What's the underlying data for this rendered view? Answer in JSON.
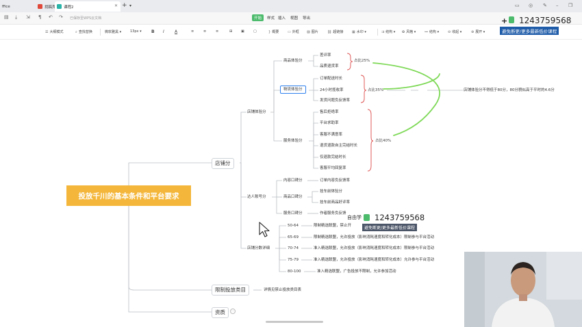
{
  "tabs": [
    {
      "label": "ffice"
    },
    {
      "label": "找稿壳模板"
    },
    {
      "label": "课程2"
    }
  ],
  "titlebar": {
    "saved": "已保存至WPS云文档",
    "menus": [
      "开始",
      "样式",
      "插入",
      "视图",
      "导出"
    ]
  },
  "toolbar": {
    "items": [
      "大纲模式",
      "查找替换",
      "微软雅黑",
      "13px",
      "B",
      "I",
      "A",
      "概要",
      "外框",
      "图片",
      "超链接",
      "水印",
      "结构",
      "风格",
      "结构",
      "收起",
      "展开"
    ]
  },
  "promo": {
    "number": "1243759568",
    "subtitle": "避免断更/更多最新低价课程",
    "plus": "+"
  },
  "watermark": {
    "prefix": "自由学",
    "number": "1243759568",
    "subtitle": "避免断更/更多最新低价课程"
  },
  "mindmap": {
    "root": "投放千川的基本条件和平台要求",
    "level1": [
      "店铺分",
      "限制投放类目",
      "资质"
    ],
    "level2": [
      "店铺体验分",
      "达人账号分",
      "店铺分数详细"
    ],
    "store_exp": {
      "groups": [
        "商品体验分",
        "物流体验分",
        "服务体验分"
      ],
      "goods": [
        "差评率",
        "品质退货率"
      ],
      "goods_share": "占比25%",
      "logistics": [
        "订单配送时长",
        "24小时揽收率",
        "发货问题负反馈率"
      ],
      "logistics_share": "占比35%",
      "logistics_note": "店铺体验分不得低于80分，80分貌似高于平时的4.6分",
      "service": [
        "售后拒绝率",
        "平台求助率",
        "客服不满意率",
        "退货退款自主完结时长",
        "仅退款完结时长",
        "客服平均回复率"
      ],
      "service_share": "占比40%"
    },
    "talent": {
      "groups": [
        "内容口碑分",
        "商品口碑分",
        "服务口碑分"
      ],
      "content": "订单内容负反馈率",
      "goods": [
        "挂车前体验分",
        "挂车前商品好评率"
      ],
      "service": "作者服务负反馈"
    },
    "score_detail": {
      "rows": [
        {
          "range": "50-64",
          "text": "限制精选联盟，禁止开"
        },
        {
          "range": "65-69",
          "text": "限制精选联盟，允许投放（影响消耗速度和转化成本）限制参与平台活动"
        },
        {
          "range": "70-74",
          "text": "准入精选联盟，允许投放（影响消耗速度和转化成本）限制参与平台活动"
        },
        {
          "range": "75-79",
          "text": "准入精选联盟，允许投放（影响消耗速度和转化成本）允许参与平台活动"
        },
        {
          "range": "80-100",
          "text": "准入精选联盟，广告投放不限制，允许参加活动"
        }
      ]
    },
    "restrict_note": "详情见禁止投放类目表"
  },
  "colors": {
    "root_bg": "#f4b73b",
    "bracket": "#e05a5a",
    "highlight_curve": "#7ed957",
    "connector": "#b8bcc2",
    "selection": "#2f80ed"
  }
}
